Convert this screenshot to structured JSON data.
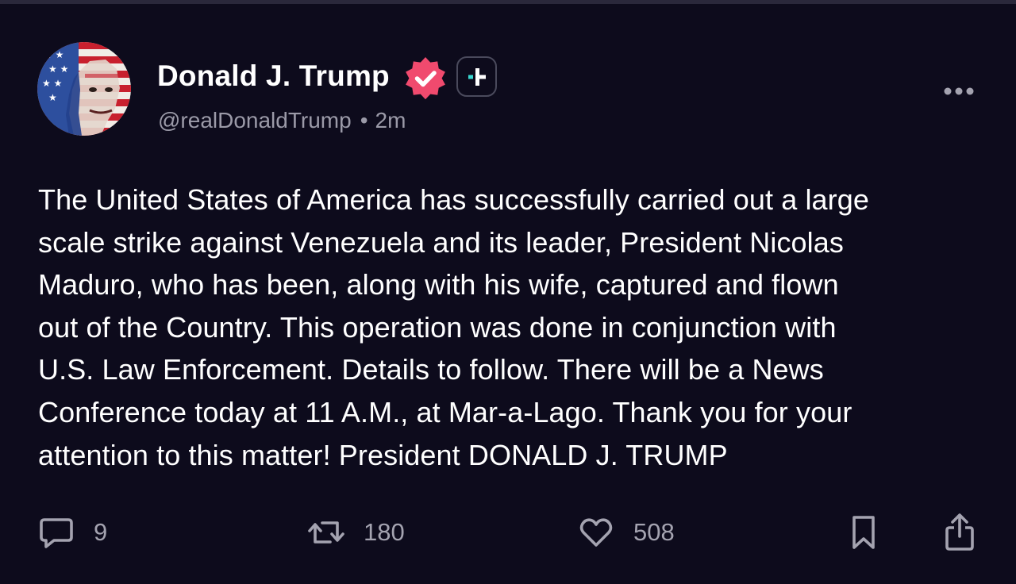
{
  "author": {
    "display_name": "Donald J. Trump",
    "handle": "@realDonaldTrump",
    "time_ago": "2m",
    "separator": "•",
    "verified": true,
    "avatar_icon": "avatar-flag-portrait"
  },
  "post": {
    "text": "The United States of America has successfully carried out a large\nscale strike against Venezuela and its leader, President Nicolas\nMaduro, who has been, along with his wife, captured and flown\nout of the Country. This operation was done in conjunction with\nU.S. Law Enforcement. Details to follow. There will be a News\nConference today at 11 A.M., at Mar-a-Lago. Thank you for your\nattention to this matter! President DONALD J. TRUMP"
  },
  "actions": {
    "replies": "9",
    "retruths": "180",
    "likes": "508"
  },
  "icons": {
    "verified": "verified-badge-icon",
    "plus": "plus-badge-icon",
    "more": "more-options-icon",
    "reply": "reply-icon",
    "retruth": "retruth-icon",
    "like": "heart-icon",
    "bookmark": "bookmark-icon",
    "share": "share-icon"
  },
  "colors": {
    "background": "#0d0b1c",
    "verified": "#f04a6e",
    "plus_accent": "#39d8d0",
    "secondary_text": "#9b9aa8"
  }
}
